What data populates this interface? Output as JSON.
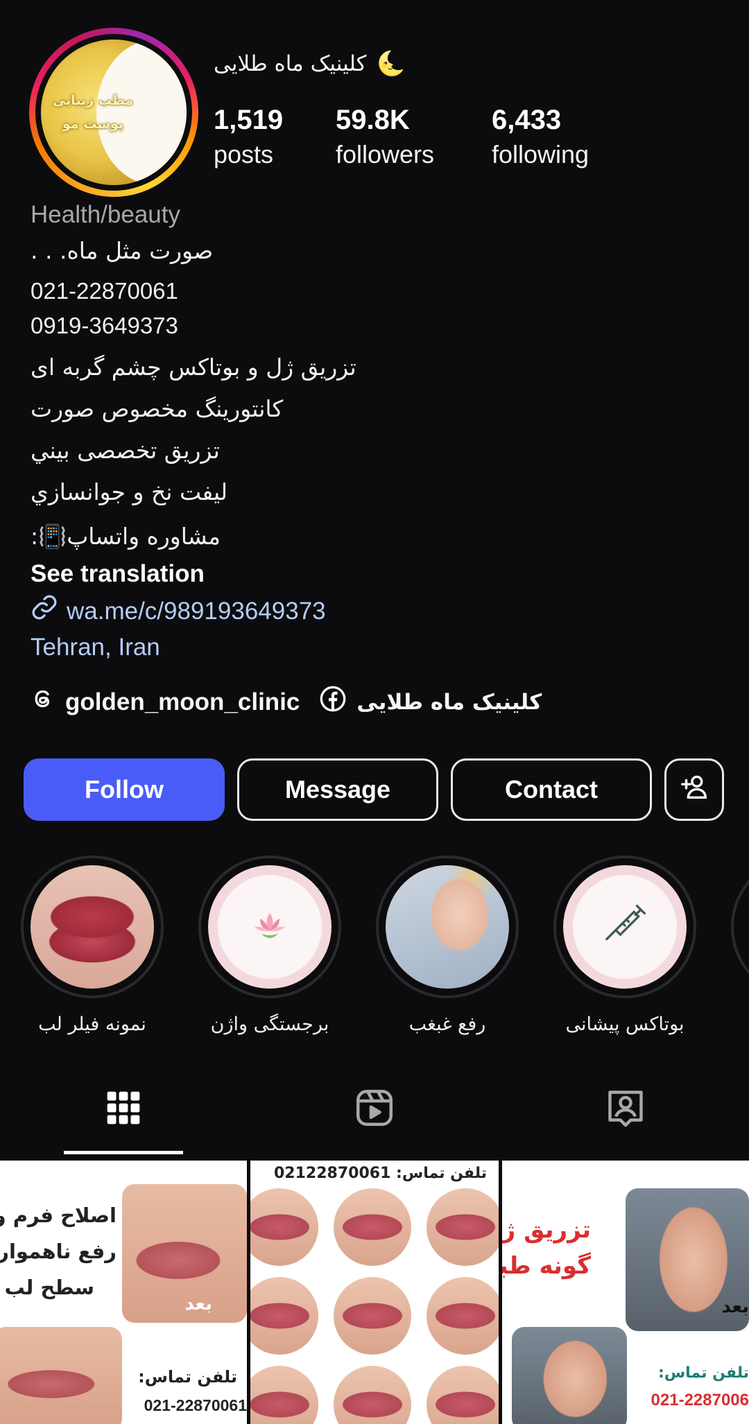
{
  "profile": {
    "display_name": "کلینیک ماه طلایی",
    "name_emoji": "🌜",
    "avatar_text": "مطب زیبایی پوست مو",
    "stats": {
      "posts_count": "1,519",
      "posts_label": "posts",
      "followers_count": "59.8K",
      "followers_label": "followers",
      "following_count": "6,433",
      "following_label": "following"
    }
  },
  "bio": {
    "category": "Health/beauty",
    "lines": [
      "صورت مثل ماه. . .",
      "021-22870061",
      "0919-3649373",
      "تزریق ژل و بوتاکس چشم گربه ای",
      "کانتورینگ مخصوص صورت",
      "تزريق تخصصى بيني",
      "ليفت نخ و جوانسازي",
      "مشاوره واتساپ📳:"
    ],
    "see_translation": "See translation",
    "link": "wa.me/c/989193649373",
    "location": "Tehran, Iran"
  },
  "socials": {
    "threads_handle": "golden_moon_clinic",
    "facebook_name": "کلینیک ماه طلایی"
  },
  "actions": {
    "follow": "Follow",
    "message": "Message",
    "contact": "Contact"
  },
  "highlights": [
    {
      "label": "نمونه فیلر لب"
    },
    {
      "label": "برجستگی واژن"
    },
    {
      "label": "رفع غبغب"
    },
    {
      "label": "بوتاکس پیشانی"
    }
  ],
  "grid": {
    "tile1": {
      "line1": "اصلاح فرم و",
      "line2": "رفع ناهمواری",
      "line3": "سطح لب",
      "after_label": "بعد",
      "phone_label": "تلفن تماس:",
      "phone": "021-22870061"
    },
    "tile2": {
      "phone_header": "تلفن تماس: 02122870061"
    },
    "tile3": {
      "line1": "تزریق ژل",
      "line2": "گونه طبیعی",
      "after_label": "بعد",
      "phone_label": "تلفن تماس:",
      "phone": "021-2287006"
    }
  },
  "colors": {
    "background": "#0c0c0e",
    "follow_button": "#4a5cf7",
    "link": "#b4cdf6",
    "secondary_text": "#a8a8a8"
  },
  "icons": [
    "threads-icon",
    "facebook-icon",
    "link-icon",
    "add-user-icon",
    "grid-icon",
    "reels-icon",
    "tagged-icon",
    "syringe-icon",
    "lotus-icon"
  ]
}
